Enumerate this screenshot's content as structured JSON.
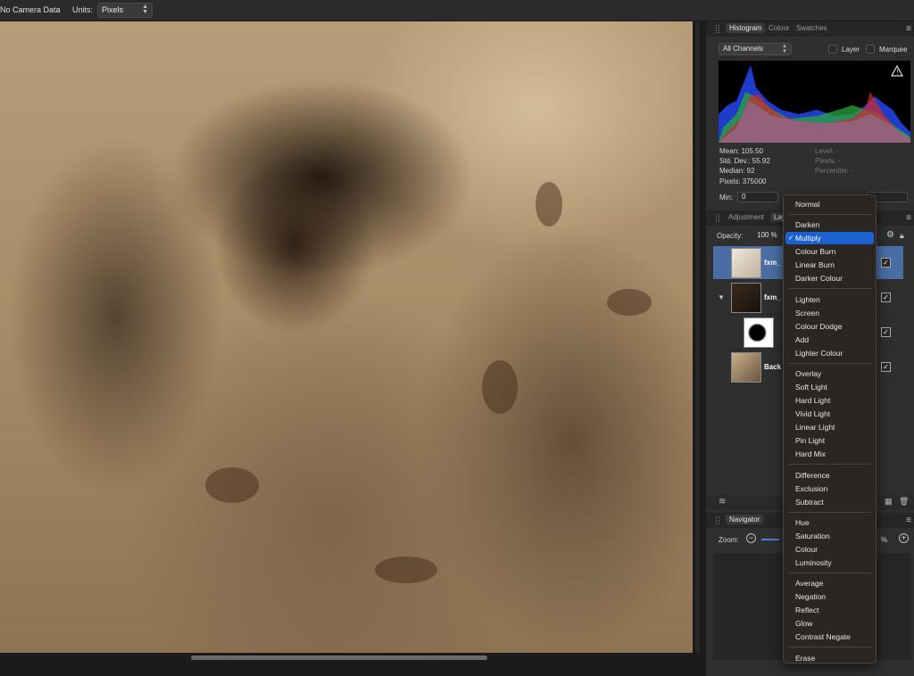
{
  "toolbar": {
    "camera": "No Camera Data",
    "units_label": "Units:",
    "units_value": "Pixels"
  },
  "histogram_panel": {
    "tabs": [
      "Histogram",
      "Colour",
      "Swatches"
    ],
    "channels": "All Channels",
    "layer_label": "Layer",
    "marquee_label": "Marquee",
    "stats": {
      "mean": "Mean: 105.50",
      "std": "Std. Dev.: 55.92",
      "median": "Median: 92",
      "pixels": "Pixels: 375000",
      "level": "Level: -",
      "pixels_sel": "Pixels: -",
      "percentile": "Percentile: -"
    },
    "min_label": "Min:",
    "min_value": "0",
    "warning_icon": "warning-icon"
  },
  "layers_panel": {
    "tabs": [
      "Adjustment",
      "Lay"
    ],
    "opacity_label": "Opacity:",
    "opacity_value": "100 %",
    "layers": [
      {
        "name": "fxm_",
        "selected": true,
        "visible": true
      },
      {
        "name": "fxm_",
        "selected": false,
        "visible": true,
        "expand_icon": "disclosure-triangle-icon"
      },
      {
        "name": "",
        "selected": false,
        "visible": true,
        "mask": true
      },
      {
        "name": "Back",
        "selected": false,
        "visible": true
      }
    ]
  },
  "navigator_panel": {
    "title": "Navigator",
    "zoom_label": "Zoom:",
    "zoom_value": "%"
  },
  "blend_menu": {
    "selected": "Multiply",
    "groups": [
      [
        "Normal"
      ],
      [
        "Darken",
        "Multiply",
        "Colour Burn",
        "Linear Burn",
        "Darker Colour"
      ],
      [
        "Lighten",
        "Screen",
        "Colour Dodge",
        "Add",
        "Lighter Colour"
      ],
      [
        "Overlay",
        "Soft Light",
        "Hard Light",
        "Vivid Light",
        "Linear Light",
        "Pin Light",
        "Hard Mix"
      ],
      [
        "Difference",
        "Exclusion",
        "Subtract"
      ],
      [
        "Hue",
        "Saturation",
        "Colour",
        "Luminosity"
      ],
      [
        "Average",
        "Negation",
        "Reflect",
        "Glow",
        "Contrast Negate"
      ],
      [
        "Erase"
      ]
    ]
  },
  "colors": {
    "accent": "#1b62d0",
    "selected_layer": "#4a6ea3",
    "panel": "#2f2f2f"
  }
}
